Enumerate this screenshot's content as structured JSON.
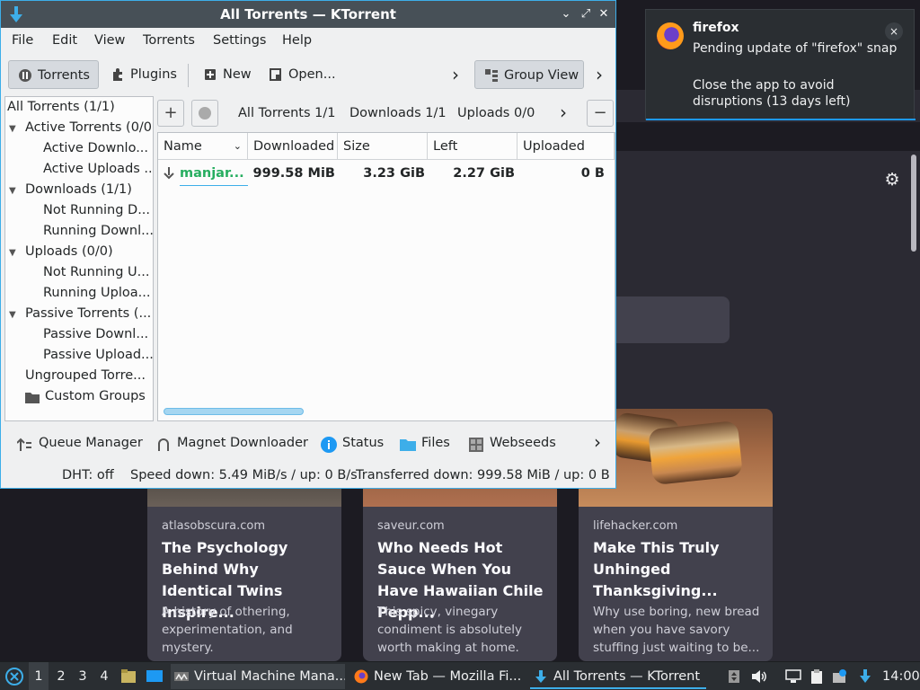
{
  "kt": {
    "window_title": "All Torrents — KTorrent",
    "menu": [
      "File",
      "Edit",
      "View",
      "Torrents",
      "Settings",
      "Help"
    ],
    "toolbar": {
      "torrents": "Torrents",
      "plugins": "Plugins",
      "new": "New",
      "open": "Open...",
      "group_view": "Group View",
      "more": "›"
    },
    "sidebar": [
      "All Torrents (1/1)",
      "Active Torrents (0/0)",
      "Active Downlo...",
      "Active Uploads ...",
      "Downloads (1/1)",
      "Not Running D...",
      "Running Downl...",
      "Uploads (0/0)",
      "Not Running U...",
      "Running Uploa...",
      "Passive Torrents (...",
      "Passive Downl...",
      "Passive Upload...",
      "Ungrouped Torre...",
      "Custom Groups"
    ],
    "tabs": {
      "all": "All Torrents 1/1",
      "downloads": "Downloads 1/1",
      "uploads": "Uploads 0/0"
    },
    "columns": [
      "Name",
      "Downloaded",
      "Size",
      "Left",
      "Uploaded"
    ],
    "torrent": {
      "name": "manjar...",
      "downloaded": "999.58 MiB",
      "size": "3.23 GiB",
      "left": "2.27 GiB",
      "uploaded": "0 B"
    },
    "bottom_tabs": {
      "queue": "Queue Manager",
      "magnet": "Magnet Downloader",
      "status": "Status",
      "files": "Files",
      "webseeds": "Webseeds"
    },
    "status": {
      "dht": "DHT: off",
      "speed": "Speed down: 5.49 MiB/s / up: 0 B/s",
      "transferred": "Transferred down: 999.58 MiB / up: 0 B"
    }
  },
  "notification": {
    "app": "firefox",
    "title": "Pending update of \"firefox\" snap",
    "body": "Close the app to avoid disruptions (13 days left)",
    "close": "×"
  },
  "firefox": {
    "cards": [
      {
        "source": "atlasobscura.com",
        "title": "The Psychology Behind Why Identical Twins Inspire...",
        "desc": "A history of othering, experimentation, and mystery."
      },
      {
        "source": "saveur.com",
        "title": "Who Needs Hot Sauce When You Have Hawaiian Chile Pepp...",
        "desc": "This spicy, vinegary condiment is absolutely worth making at home."
      },
      {
        "source": "lifehacker.com",
        "title": "Make This Truly Unhinged Thanksgiving...",
        "desc": "Why use boring, new bread when you have savory stuffing just waiting to be..."
      }
    ]
  },
  "taskbar": {
    "desktops": [
      "1",
      "2",
      "3",
      "4"
    ],
    "tasks": [
      "Virtual Machine Mana...",
      "New Tab — Mozilla Fi...",
      "All Torrents — KTorrent"
    ],
    "clock": "14:00"
  },
  "colors": {
    "accent": "#3daee9",
    "torrent_name": "#27ae60",
    "titlebar": "#475057"
  }
}
